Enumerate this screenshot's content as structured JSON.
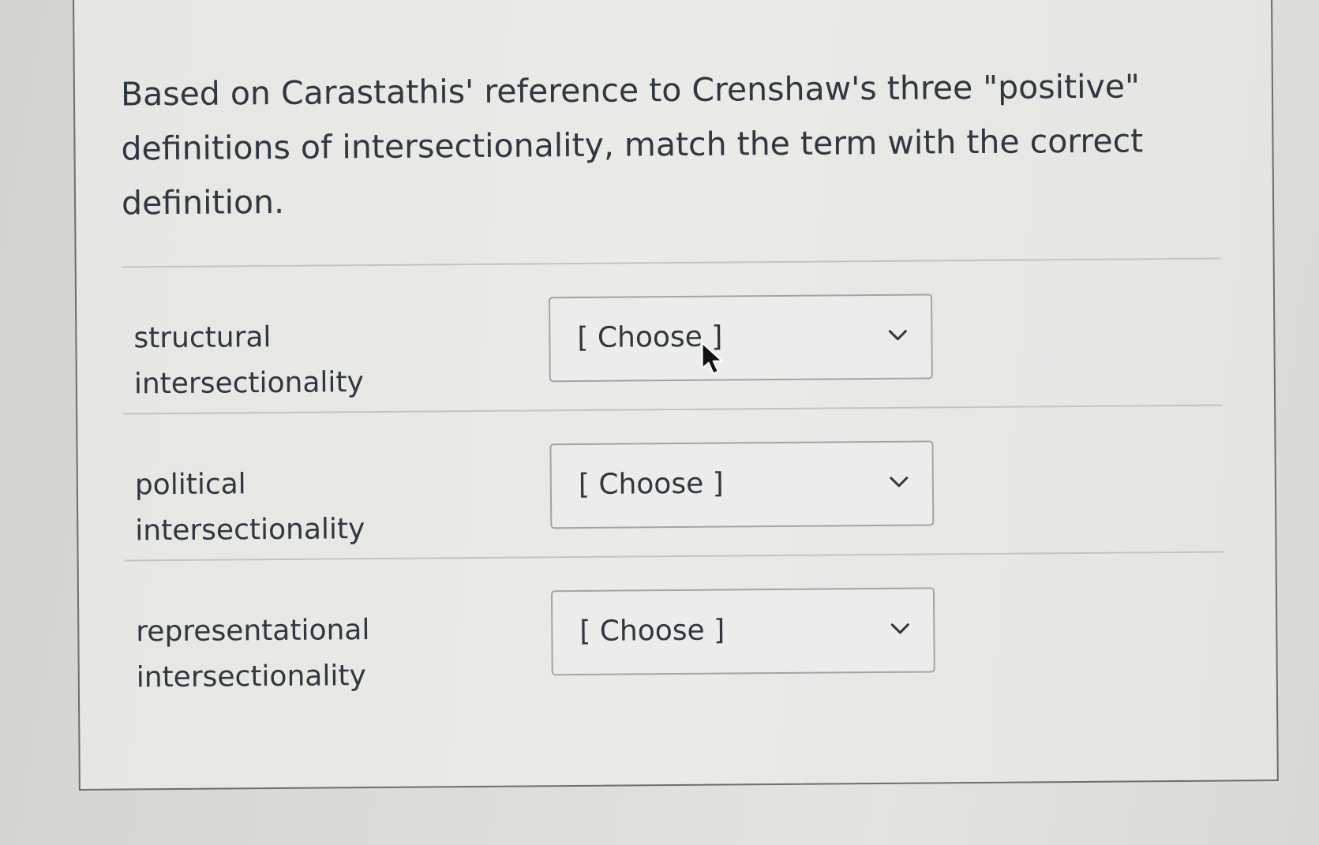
{
  "question": {
    "text": "Based on Carastathis' reference to Crenshaw's three \"positive\" definitions of intersectionality, match the term with the correct definition."
  },
  "matches": [
    {
      "term": "structural intersectionality",
      "selected": "[ Choose ]"
    },
    {
      "term": "political intersectionality",
      "selected": "[ Choose ]"
    },
    {
      "term": "representational intersectionality",
      "selected": "[ Choose ]"
    }
  ],
  "icons": {
    "dropdown": "chevron-down-icon",
    "pointer": "mouse-cursor-icon"
  },
  "colors": {
    "text": "#2f3740",
    "select_border": "#a2a5a7",
    "divider": "#c4c4c1"
  }
}
